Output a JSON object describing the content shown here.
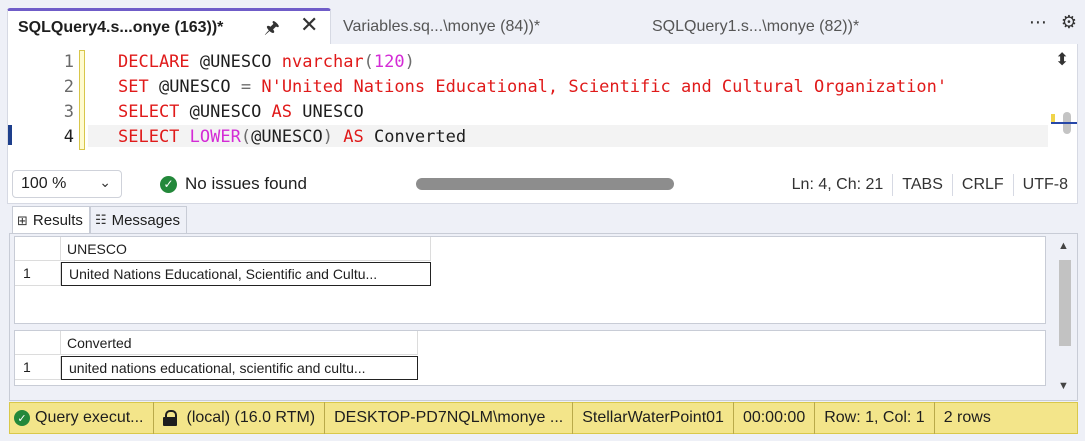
{
  "tabs": [
    {
      "label": "SQLQuery4.s...onye (163))*",
      "active": true
    },
    {
      "label": "Variables.sq...\\monye (84))*",
      "active": false
    },
    {
      "label": "SQLQuery1.s...\\monye (82))*",
      "active": false
    }
  ],
  "tab_actions": {
    "overflow_icon": "⋯",
    "settings_icon": "⚙"
  },
  "editor": {
    "line_numbers": [
      "1",
      "2",
      "3",
      "4"
    ],
    "lines": [
      [
        {
          "t": "DECLARE",
          "c": "kw"
        },
        {
          "t": " @UNESCO ",
          "c": "id"
        },
        {
          "t": "nvarchar",
          "c": "kw"
        },
        {
          "t": "(",
          "c": "op"
        },
        {
          "t": "120",
          "c": "num"
        },
        {
          "t": ")",
          "c": "op"
        }
      ],
      [
        {
          "t": "SET",
          "c": "kw"
        },
        {
          "t": " @UNESCO ",
          "c": "id"
        },
        {
          "t": "=",
          "c": "op"
        },
        {
          "t": " ",
          "c": "id"
        },
        {
          "t": "N'United Nations Educational, Scientific and Cultural Organization'",
          "c": "str"
        }
      ],
      [
        {
          "t": "SELECT",
          "c": "kw"
        },
        {
          "t": " @UNESCO ",
          "c": "id"
        },
        {
          "t": "AS",
          "c": "kw"
        },
        {
          "t": " UNESCO",
          "c": "id"
        }
      ],
      [
        {
          "t": "SELECT",
          "c": "kw"
        },
        {
          "t": " ",
          "c": "id"
        },
        {
          "t": "LOWER",
          "c": "fn"
        },
        {
          "t": "(",
          "c": "op"
        },
        {
          "t": "@UNESCO",
          "c": "id"
        },
        {
          "t": ")",
          "c": "op"
        },
        {
          "t": " ",
          "c": "id"
        },
        {
          "t": "AS",
          "c": "kw"
        },
        {
          "t": " Converted",
          "c": "id"
        }
      ]
    ]
  },
  "editor_status": {
    "zoom": "100 %",
    "issues": "No issues found",
    "position": "Ln: 4, Ch: 21",
    "indent": "TABS",
    "line_ending": "CRLF",
    "encoding": "UTF-8"
  },
  "result_tabs": [
    {
      "label": "Results",
      "icon": "⊞",
      "active": true
    },
    {
      "label": "Messages",
      "icon": "☷",
      "active": false
    }
  ],
  "result_sets": [
    {
      "column": "UNESCO",
      "rows": [
        {
          "num": "1",
          "value": "United Nations Educational, Scientific and Cultu..."
        }
      ]
    },
    {
      "column": "Converted",
      "rows": [
        {
          "num": "1",
          "value": "united nations educational, scientific and cultu..."
        }
      ]
    }
  ],
  "status_bar": {
    "query_state": "Query  execut...",
    "server": "(local) (16.0 RTM)",
    "login": "DESKTOP-PD7NQLM\\monye ...",
    "database": "StellarWaterPoint01",
    "elapsed": "00:00:00",
    "cursor": "Row: 1, Col: 1",
    "rows": "2 rows"
  },
  "colors": {
    "accent": "#6f5cc8",
    "keyword": "#e01a1a",
    "function": "#d42bd6",
    "status_bar": "#f3e58a",
    "ok_green": "#23883a"
  }
}
